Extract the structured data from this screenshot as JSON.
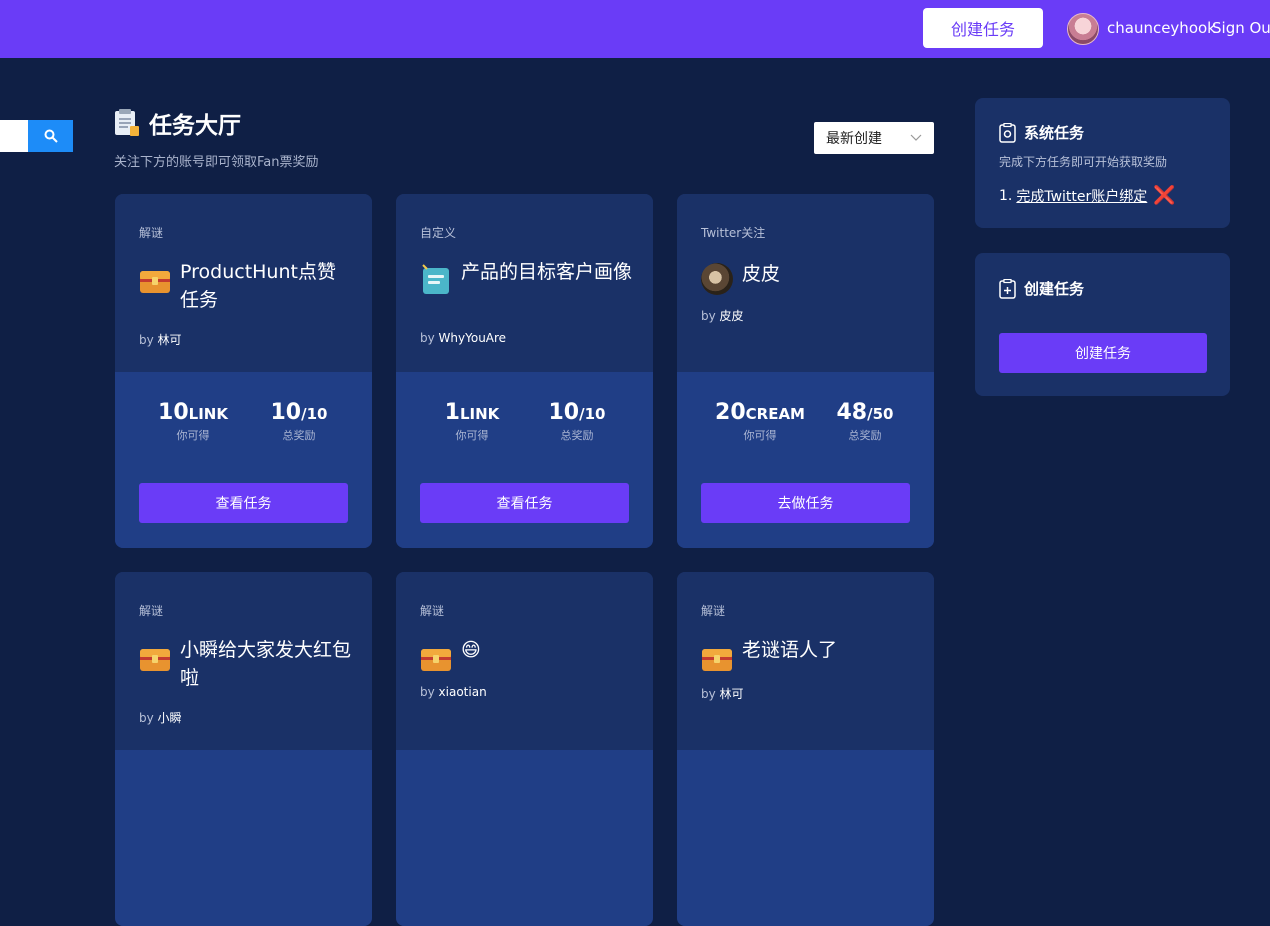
{
  "header": {
    "create_label": "创建任务",
    "username": "chaunceyhook",
    "signout_label": "Sign Out"
  },
  "search": {
    "placeholder": ""
  },
  "main": {
    "title": "任务大厅",
    "subtitle": "关注下方的账号即可领取Fan票奖励",
    "sort_selected": "最新创建"
  },
  "cards": [
    {
      "category": "解谜",
      "title": "ProductHunt点赞任务",
      "author_prefix": "by",
      "author": "林可",
      "icon": "treasure-chest-icon",
      "earn_value": "10",
      "earn_unit": "LINK",
      "earn_label": "你可得",
      "total_value": "10",
      "total_unit": "/10",
      "total_label": "总奖励",
      "button": "查看任务"
    },
    {
      "category": "自定义",
      "title": "产品的目标客户画像",
      "author_prefix": "by",
      "author": "WhyYouAre",
      "icon": "notepad-icon",
      "earn_value": "1",
      "earn_unit": "LINK",
      "earn_label": "你可得",
      "total_value": "10",
      "total_unit": "/10",
      "total_label": "总奖励",
      "button": "查看任务"
    },
    {
      "category": "Twitter关注",
      "title": "皮皮",
      "author_prefix": "by",
      "author": "皮皮",
      "icon": "avatar-photo",
      "earn_value": "20",
      "earn_unit": "CREAM",
      "earn_label": "你可得",
      "total_value": "48",
      "total_unit": "/50",
      "total_label": "总奖励",
      "button": "去做任务"
    },
    {
      "category": "解谜",
      "title": "小瞬给大家发大红包啦",
      "author_prefix": "by",
      "author": "小瞬",
      "icon": "treasure-chest-icon"
    },
    {
      "category": "解谜",
      "title": "😄",
      "author_prefix": "by",
      "author": "xiaotian",
      "icon": "treasure-chest-icon"
    },
    {
      "category": "解谜",
      "title": "老谜语人了",
      "author_prefix": "by",
      "author": "林可",
      "icon": "treasure-chest-icon"
    }
  ],
  "sidebar": {
    "system": {
      "title": "系统任务",
      "desc": "完成下方任务即可开始获取奖励",
      "task_number": "1.",
      "task_label": "完成Twitter账户绑定",
      "task_status": "❌"
    },
    "create": {
      "title": "创建任务",
      "button": "创建任务"
    }
  },
  "colors": {
    "accent": "#6a3cf7",
    "bg": "#0f1f45",
    "card": "#1a3167",
    "card_bottom": "#203e86",
    "search_btn": "#1d8cf8"
  }
}
